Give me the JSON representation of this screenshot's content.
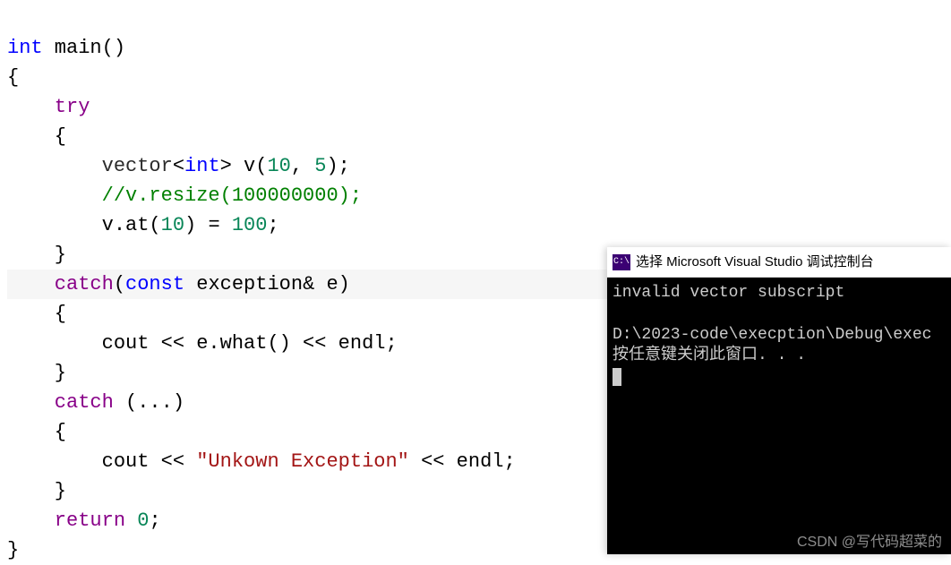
{
  "code": {
    "l1a": "int",
    "l1b": " main()",
    "l2": "{",
    "l3": "    try",
    "l4": "    {",
    "l5a": "        vector",
    "l5b": "<",
    "l5c": "int",
    "l5d": "> v(",
    "l5e": "10",
    "l5f": ", ",
    "l5g": "5",
    "l5h": ");",
    "l6": "        //v.resize(100000000);",
    "l7a": "        v.at(",
    "l7b": "10",
    "l7c": ") = ",
    "l7d": "100",
    "l7e": ";",
    "l8": "    }",
    "l9a": "    catch",
    "l9b": "(",
    "l9c": "const",
    "l9d": " exception& e)",
    "l10": "    {",
    "l11a": "        cout << e.what() << endl;",
    "l12": "    }",
    "l13a": "    catch",
    "l13b": " (...)",
    "l14": "    {",
    "l15a": "        cout << ",
    "l15b": "\"Unkown Exception\"",
    "l15c": " << endl;",
    "l16": "    }",
    "l17a": "    return",
    "l17b": " ",
    "l17c": "0",
    "l17d": ";",
    "l18": "}"
  },
  "console": {
    "title": "选择 Microsoft Visual Studio 调试控制台",
    "icon_text": "C:\\",
    "line1": "invalid vector subscript",
    "line2": "",
    "line3": "D:\\2023-code\\execption\\Debug\\exec",
    "line4": "按任意键关闭此窗口. . ."
  },
  "watermark": "CSDN @写代码超菜的"
}
